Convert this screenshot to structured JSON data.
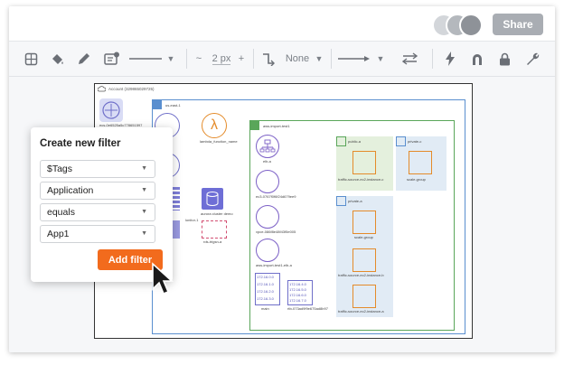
{
  "header": {
    "share_label": "Share",
    "avatar_colors": [
      "#d3d6da",
      "#b4b8bd",
      "#8e9298"
    ]
  },
  "toolbar": {
    "line_width": "2 px",
    "decrease": "~",
    "increase": "+",
    "endpoint": "None"
  },
  "diagram": {
    "account_label": "Account (329865029725)",
    "region_label": "us-east-1",
    "vpc_label": "aws-import-test1",
    "lambda_label": "lambda_function_name",
    "aurora_label": "aurora cluster demo",
    "elb_label": "elb-a",
    "sg_a_label": "public-a",
    "sg_c_label": "private-c",
    "private_a_label": "private-a",
    "dynamo_label": "rds-trigsn-a",
    "subnet_small_label": "scale-group",
    "instance_labels": [
      "traffic-source-ec2-instance-c",
      "scale-group",
      "traffic-source-ec2-instance-b",
      "traffic-source-ec2-instance-a"
    ],
    "endpoint_labels": [
      "ec3-0767f0f6f24d679ee9",
      "vpce-086f8e48f43f5e005",
      "aws-import-test1-elb-a"
    ],
    "ip_blocks_left": [
      "172.16.0.0",
      "172.16.1.0",
      "172.16.2.0",
      "172.16.3.0"
    ],
    "ip_blocks_right": [
      "172.16.4.0",
      "172.16.5.0",
      "172.16.6.0",
      "172.16.7.0"
    ],
    "main_label": "main",
    "rtb_label": "rtb-073ad9f9e675ad8b97",
    "left_partial_1": "ecs-0e6525a5c778651597",
    "left_partial_2": "lonitor-1"
  },
  "filter_popup": {
    "title": "Create new filter",
    "fields": [
      {
        "value": "$Tags"
      },
      {
        "value": "Application"
      },
      {
        "value": "equals"
      },
      {
        "value": "App1"
      }
    ],
    "add_label": "Add filter",
    "accent": "#f26b1d"
  }
}
